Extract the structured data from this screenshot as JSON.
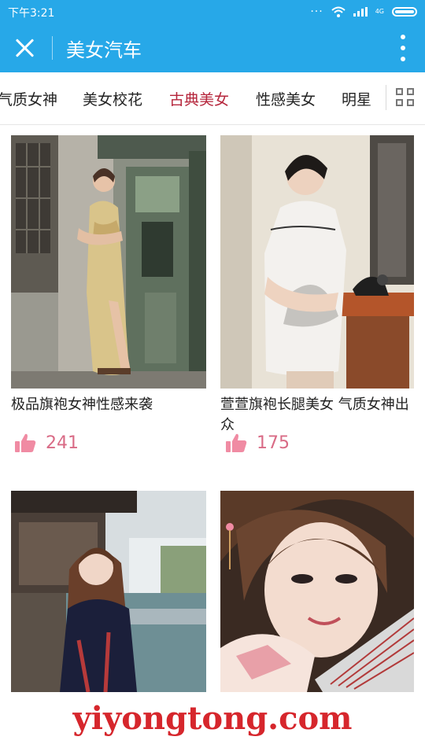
{
  "status_bar": {
    "time": "下午3:21",
    "network": "4G"
  },
  "app_bar": {
    "title": "美女汽车"
  },
  "tabs": [
    "气质女神",
    "美女校花",
    "古典美女",
    "性感美女",
    "明星"
  ],
  "active_tab_index": 2,
  "colors": {
    "accent": "#27a8e8",
    "active_tab": "#b5253b",
    "like": "#d96b86",
    "watermark": "#d6262c"
  },
  "cards": [
    {
      "caption": "极品旗袍女神性感来袭",
      "likes": "241"
    },
    {
      "caption": "萱萱旗袍长腿美女 气质女神出众",
      "likes": "175"
    },
    {
      "caption": "",
      "likes": ""
    },
    {
      "caption": "",
      "likes": ""
    }
  ],
  "watermark": "yiyongtong.com"
}
